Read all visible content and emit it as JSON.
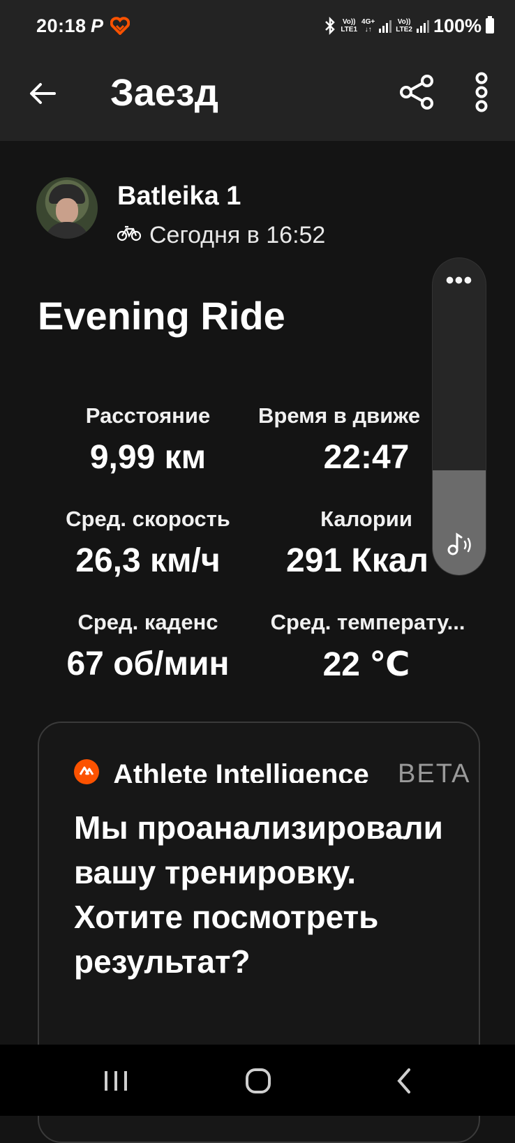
{
  "status_bar": {
    "time": "20:18",
    "app_glyph": "P",
    "network_1": [
      "Vo))",
      "LTE1"
    ],
    "network_2": [
      "4G+",
      "↓↑"
    ],
    "network_3": [
      "Vo))",
      "LTE2"
    ],
    "battery": "100%"
  },
  "header": {
    "title": "Заезд",
    "icons": {
      "back": "arrow-left-icon",
      "share": "share-icon",
      "more": "more-vertical-icon"
    }
  },
  "activity": {
    "athlete_name": "Batleika 1",
    "time": "Сегодня в 16:52",
    "title": "Evening Ride"
  },
  "stats": [
    {
      "label": "Расстояние",
      "value": "9,99 км"
    },
    {
      "label": "Время в движе",
      "value": "22:47"
    },
    {
      "label": "Сред. скорость",
      "value": "26,3 км/ч"
    },
    {
      "label": "Калории",
      "value": "291 Ккал"
    },
    {
      "label": "Сред. каденс",
      "value": "67 об/мин"
    },
    {
      "label": "Сред. температу...",
      "value": "22 ℃"
    }
  ],
  "ai_card": {
    "title": "Athlete Intelligence",
    "badge": "BETA",
    "text": "Мы проанализировали вашу тренировку. Хотите посмотреть результат?"
  },
  "volume_panel": {
    "menu": "•••",
    "level": 0.33
  },
  "colors": {
    "accent": "#fc5200",
    "background": "#141414",
    "bar": "#232323"
  }
}
